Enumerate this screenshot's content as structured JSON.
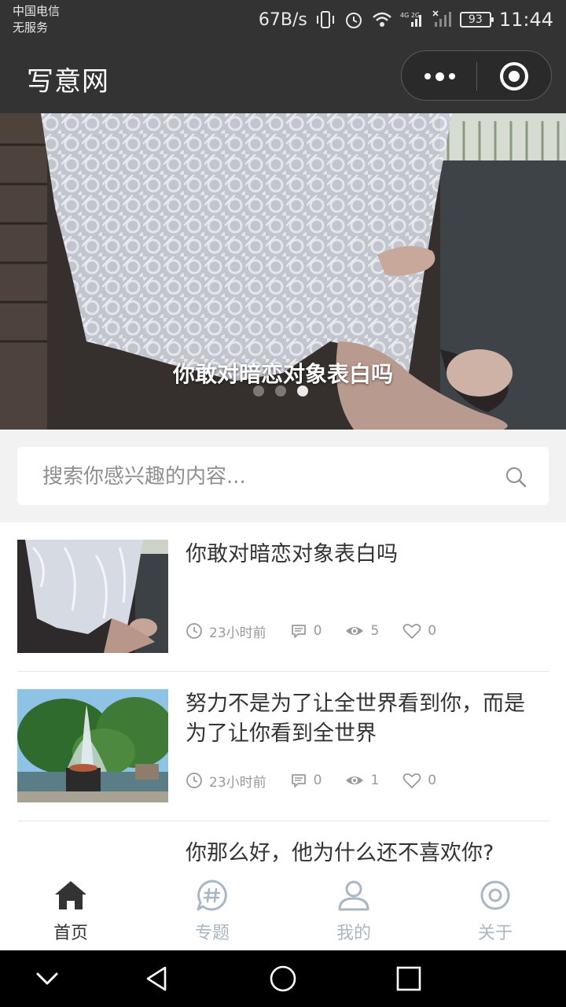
{
  "status_bar": {
    "carrier_line1": "中国电信",
    "carrier_line2": "无服务",
    "net_speed": "67B/s",
    "network": "4G 2G",
    "battery": "93",
    "time": "11:44"
  },
  "header": {
    "title": "写意网"
  },
  "banner": {
    "caption": "你敢对暗恋对象表白吗",
    "slide_count": 3,
    "active_slide": 3
  },
  "search": {
    "placeholder": "搜索你感兴趣的内容..."
  },
  "articles": [
    {
      "title": "你敢对暗恋对象表白吗",
      "time": "23小时前",
      "comments": "0",
      "views": "5",
      "likes": "0"
    },
    {
      "title": "努力不是为了让全世界看到你，而是为了让你看到全世界",
      "time": "23小时前",
      "comments": "0",
      "views": "1",
      "likes": "0"
    },
    {
      "title": "你那么好，他为什么还不喜欢你?"
    }
  ],
  "tabbar": {
    "tabs": [
      {
        "label": "首页",
        "icon": "home-icon",
        "active": true
      },
      {
        "label": "专题",
        "icon": "topic-icon",
        "active": false
      },
      {
        "label": "我的",
        "icon": "user-icon",
        "active": false
      },
      {
        "label": "关于",
        "icon": "about-icon",
        "active": false
      }
    ],
    "active_color": "#333333",
    "inactive_color": "#a9b6c3"
  }
}
